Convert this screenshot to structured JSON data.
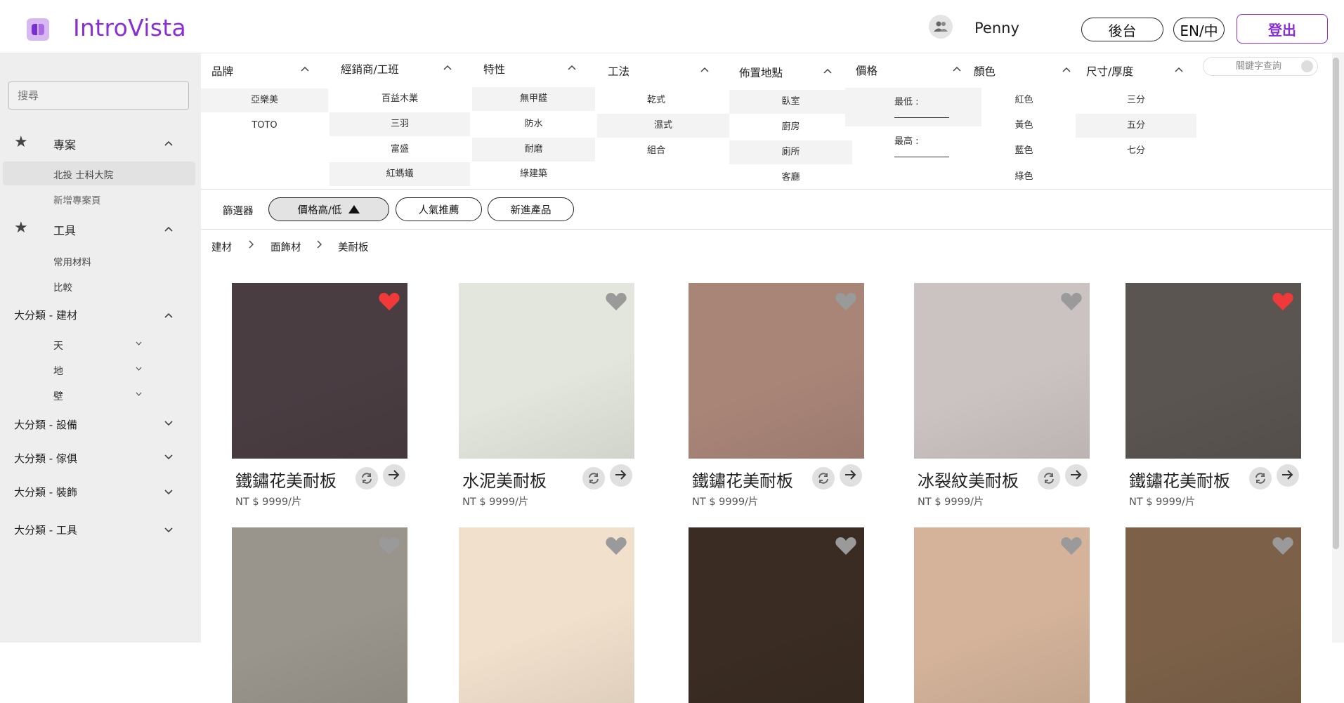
{
  "header": {
    "app_name": "IntroVista",
    "user_name": "Penny",
    "admin_label": "後台",
    "lang_label": "EN/中",
    "logout_label": "登出"
  },
  "sidebar": {
    "search_placeholder": "搜尋",
    "projects": {
      "label": "專案",
      "items": [
        "北投 士科大院",
        "新增專案頁"
      ]
    },
    "tools": {
      "label": "工具",
      "items": [
        "常用材料",
        "比較"
      ]
    },
    "categories": [
      {
        "label": "大分類 - 建材",
        "children": [
          "天",
          "地",
          "壁"
        ]
      },
      {
        "label": "大分類 - 設備"
      },
      {
        "label": "大分類 - 傢俱"
      },
      {
        "label": "大分類 - 裝飾"
      },
      {
        "label": "大分類 - 工具"
      }
    ]
  },
  "filters": {
    "keyword_placeholder": "關鍵字查詢",
    "brand": {
      "label": "品牌",
      "options": [
        "亞樂美",
        "TOTO"
      ]
    },
    "dealer": {
      "label": "經銷商/工班",
      "options": [
        "百益木業",
        "三羽",
        "富盛",
        "紅螞蟻"
      ]
    },
    "feature": {
      "label": "特性",
      "options": [
        "無甲醛",
        "防水",
        "耐磨",
        "綠建築"
      ]
    },
    "method": {
      "label": "工法",
      "options": [
        "乾式",
        "濕式",
        "組合"
      ]
    },
    "location": {
      "label": "佈置地點",
      "options": [
        "臥室",
        "廚房",
        "廁所",
        "客廳"
      ]
    },
    "price": {
      "label": "價格",
      "min_label": "最低 :",
      "max_label": "最高 :"
    },
    "color": {
      "label": "顏色",
      "options": [
        "紅色",
        "黃色",
        "藍色",
        "綠色"
      ]
    },
    "size": {
      "label": "尺寸/厚度",
      "options": [
        "三分",
        "五分",
        "七分"
      ]
    }
  },
  "sort": {
    "label": "篩選器",
    "price_label": "價格高/低",
    "popular_label": "人氣推薦",
    "new_label": "新進產品"
  },
  "breadcrumb": [
    "建材",
    "面飾材",
    "美耐板"
  ],
  "products": [
    {
      "name": "鐵鏽花美耐板",
      "price": "NT $  9999/片",
      "favorite": true,
      "color": "#4a3d42"
    },
    {
      "name": "水泥美耐板",
      "price": "NT $  9999/片",
      "favorite": false,
      "color": "#e2e6dc"
    },
    {
      "name": "鐵鏽花美耐板",
      "price": "NT $  9999/片",
      "favorite": false,
      "color": "#a98578"
    },
    {
      "name": "冰裂紋美耐板",
      "price": "NT $  9999/片",
      "favorite": false,
      "color": "#cbc3c1"
    },
    {
      "name": "鐵鏽花美耐板",
      "price": "NT $  9999/片",
      "favorite": true,
      "color": "#5b5551"
    },
    {
      "name": "",
      "price": "",
      "favorite": false,
      "color": "#9a958c"
    },
    {
      "name": "",
      "price": "",
      "favorite": false,
      "color": "#f1e0cc"
    },
    {
      "name": "",
      "price": "",
      "favorite": false,
      "color": "#3a2c22"
    },
    {
      "name": "",
      "price": "",
      "favorite": false,
      "color": "#d4b39a"
    },
    {
      "name": "",
      "price": "",
      "favorite": false,
      "color": "#7c6148"
    }
  ],
  "colors": {
    "brand": "#8a2fd8",
    "heart_active": "#f03a3a",
    "heart_inactive": "#9a9a9a"
  }
}
